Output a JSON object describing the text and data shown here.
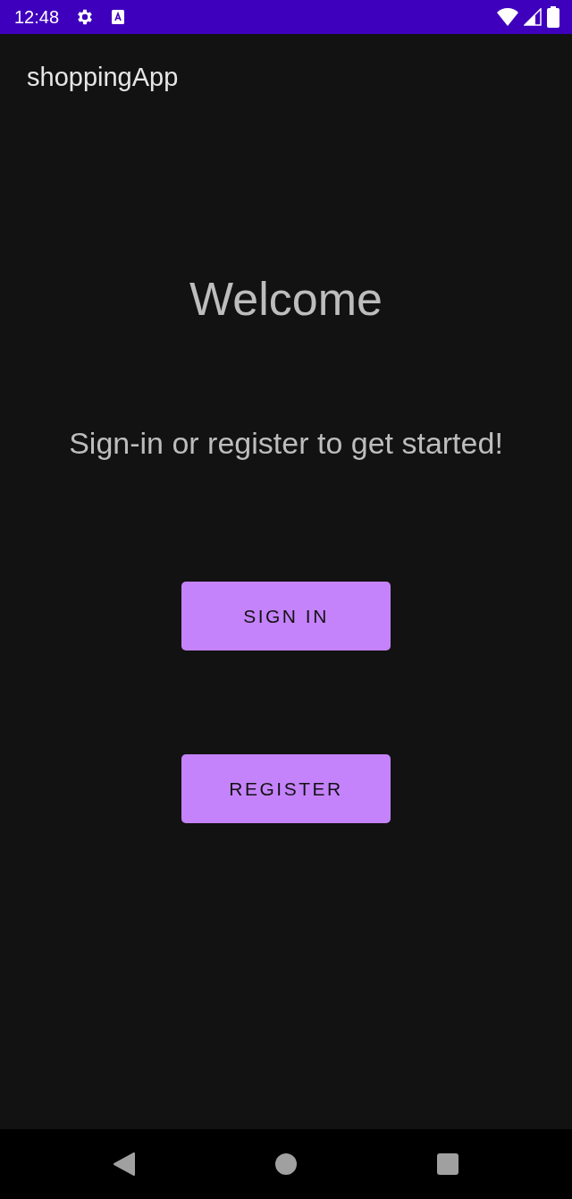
{
  "status_bar": {
    "time": "12:48"
  },
  "app_bar": {
    "title": "shoppingApp"
  },
  "welcome": {
    "heading": "Welcome",
    "subtitle": "Sign-in or register to get started!"
  },
  "buttons": [
    {
      "label": "SIGN IN"
    },
    {
      "label": "REGISTER"
    }
  ]
}
